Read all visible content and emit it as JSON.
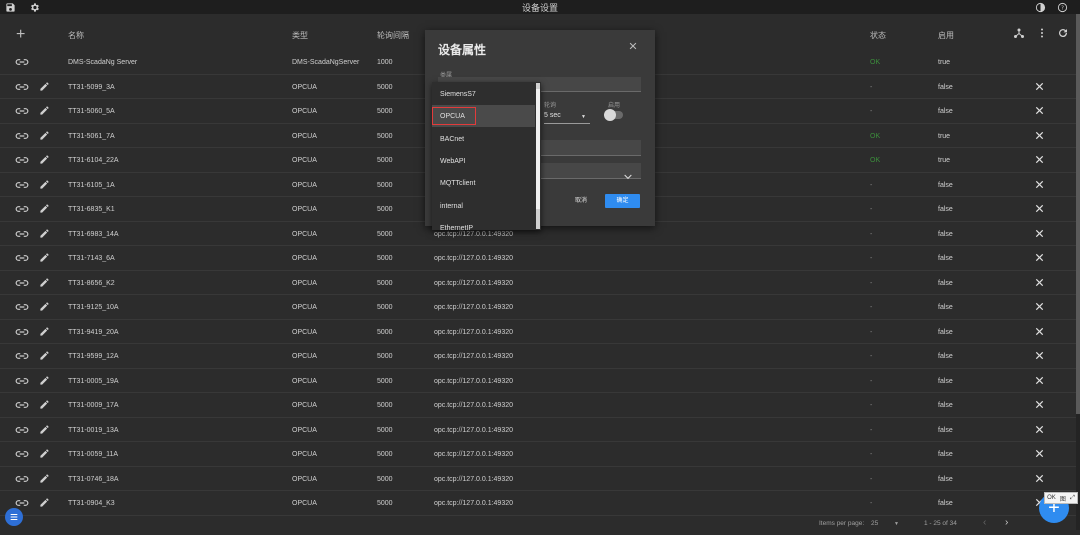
{
  "app": {
    "title": "设备设置"
  },
  "columns": {
    "name": "名称",
    "type": "类型",
    "interval": "轮询间隔",
    "status": "状态",
    "enabled": "启用"
  },
  "rows": [
    {
      "name": "DMS-ScadaNg Server",
      "type": "DMS-ScadaNgServer",
      "interval": "1000",
      "url": "",
      "status": "OK",
      "enabled": "true",
      "deletable": false
    },
    {
      "name": "TT31-5099_3A",
      "type": "OPCUA",
      "interval": "5000",
      "url": "",
      "status": "-",
      "enabled": "false",
      "deletable": true
    },
    {
      "name": "TT31-5060_5A",
      "type": "OPCUA",
      "interval": "5000",
      "url": "",
      "status": "-",
      "enabled": "false",
      "deletable": true
    },
    {
      "name": "TT31-5061_7A",
      "type": "OPCUA",
      "interval": "5000",
      "url": "",
      "status": "OK",
      "enabled": "true",
      "deletable": true
    },
    {
      "name": "TT31-6104_22A",
      "type": "OPCUA",
      "interval": "5000",
      "url": "",
      "status": "OK",
      "enabled": "true",
      "deletable": true
    },
    {
      "name": "TT31-6105_1A",
      "type": "OPCUA",
      "interval": "5000",
      "url": "",
      "status": "-",
      "enabled": "false",
      "deletable": true
    },
    {
      "name": "TT31-6835_K1",
      "type": "OPCUA",
      "interval": "5000",
      "url": "",
      "status": "-",
      "enabled": "false",
      "deletable": true
    },
    {
      "name": "TT31-6983_14A",
      "type": "OPCUA",
      "interval": "5000",
      "url": "opc.tcp://127.0.0.1:49320",
      "status": "-",
      "enabled": "false",
      "deletable": true
    },
    {
      "name": "TT31-7143_6A",
      "type": "OPCUA",
      "interval": "5000",
      "url": "opc.tcp://127.0.0.1:49320",
      "status": "-",
      "enabled": "false",
      "deletable": true
    },
    {
      "name": "TT31-8656_K2",
      "type": "OPCUA",
      "interval": "5000",
      "url": "opc.tcp://127.0.0.1:49320",
      "status": "-",
      "enabled": "false",
      "deletable": true
    },
    {
      "name": "TT31-9125_10A",
      "type": "OPCUA",
      "interval": "5000",
      "url": "opc.tcp://127.0.0.1:49320",
      "status": "-",
      "enabled": "false",
      "deletable": true
    },
    {
      "name": "TT31-9419_20A",
      "type": "OPCUA",
      "interval": "5000",
      "url": "opc.tcp://127.0.0.1:49320",
      "status": "-",
      "enabled": "false",
      "deletable": true
    },
    {
      "name": "TT31-9599_12A",
      "type": "OPCUA",
      "interval": "5000",
      "url": "opc.tcp://127.0.0.1:49320",
      "status": "-",
      "enabled": "false",
      "deletable": true
    },
    {
      "name": "TT31-0005_19A",
      "type": "OPCUA",
      "interval": "5000",
      "url": "opc.tcp://127.0.0.1:49320",
      "status": "-",
      "enabled": "false",
      "deletable": true
    },
    {
      "name": "TT31-0009_17A",
      "type": "OPCUA",
      "interval": "5000",
      "url": "opc.tcp://127.0.0.1:49320",
      "status": "-",
      "enabled": "false",
      "deletable": true
    },
    {
      "name": "TT31-0019_13A",
      "type": "OPCUA",
      "interval": "5000",
      "url": "opc.tcp://127.0.0.1:49320",
      "status": "-",
      "enabled": "false",
      "deletable": true
    },
    {
      "name": "TT31-0059_11A",
      "type": "OPCUA",
      "interval": "5000",
      "url": "opc.tcp://127.0.0.1:49320",
      "status": "-",
      "enabled": "false",
      "deletable": true
    },
    {
      "name": "TT31-0746_18A",
      "type": "OPCUA",
      "interval": "5000",
      "url": "opc.tcp://127.0.0.1:49320",
      "status": "-",
      "enabled": "false",
      "deletable": true
    },
    {
      "name": "TT31-0904_K3",
      "type": "OPCUA",
      "interval": "5000",
      "url": "opc.tcp://127.0.0.1:49320",
      "status": "-",
      "enabled": "false",
      "deletable": true
    }
  ],
  "pager": {
    "items_label": "Items per page:",
    "per_page": "25",
    "range": "1 - 25 of 34"
  },
  "dialog": {
    "title": "设备属性",
    "type_label": "类属",
    "poll_label": "轮询",
    "poll_value": "5 sec",
    "enable_label": "启用",
    "cancel": "取消",
    "confirm": "确定"
  },
  "dropdown": {
    "options": [
      "SiemensS7",
      "OPCUA",
      "BACnet",
      "WebAPI",
      "MQTTclient",
      "internal",
      "EthernetIP"
    ],
    "selected": "OPCUA"
  },
  "mini_toolbar": {
    "ok": "OK",
    "icon": "图"
  },
  "colors": {
    "accent": "#2f8cf0",
    "ok": "#3c8f3c",
    "highlight": "#e23b3b"
  }
}
